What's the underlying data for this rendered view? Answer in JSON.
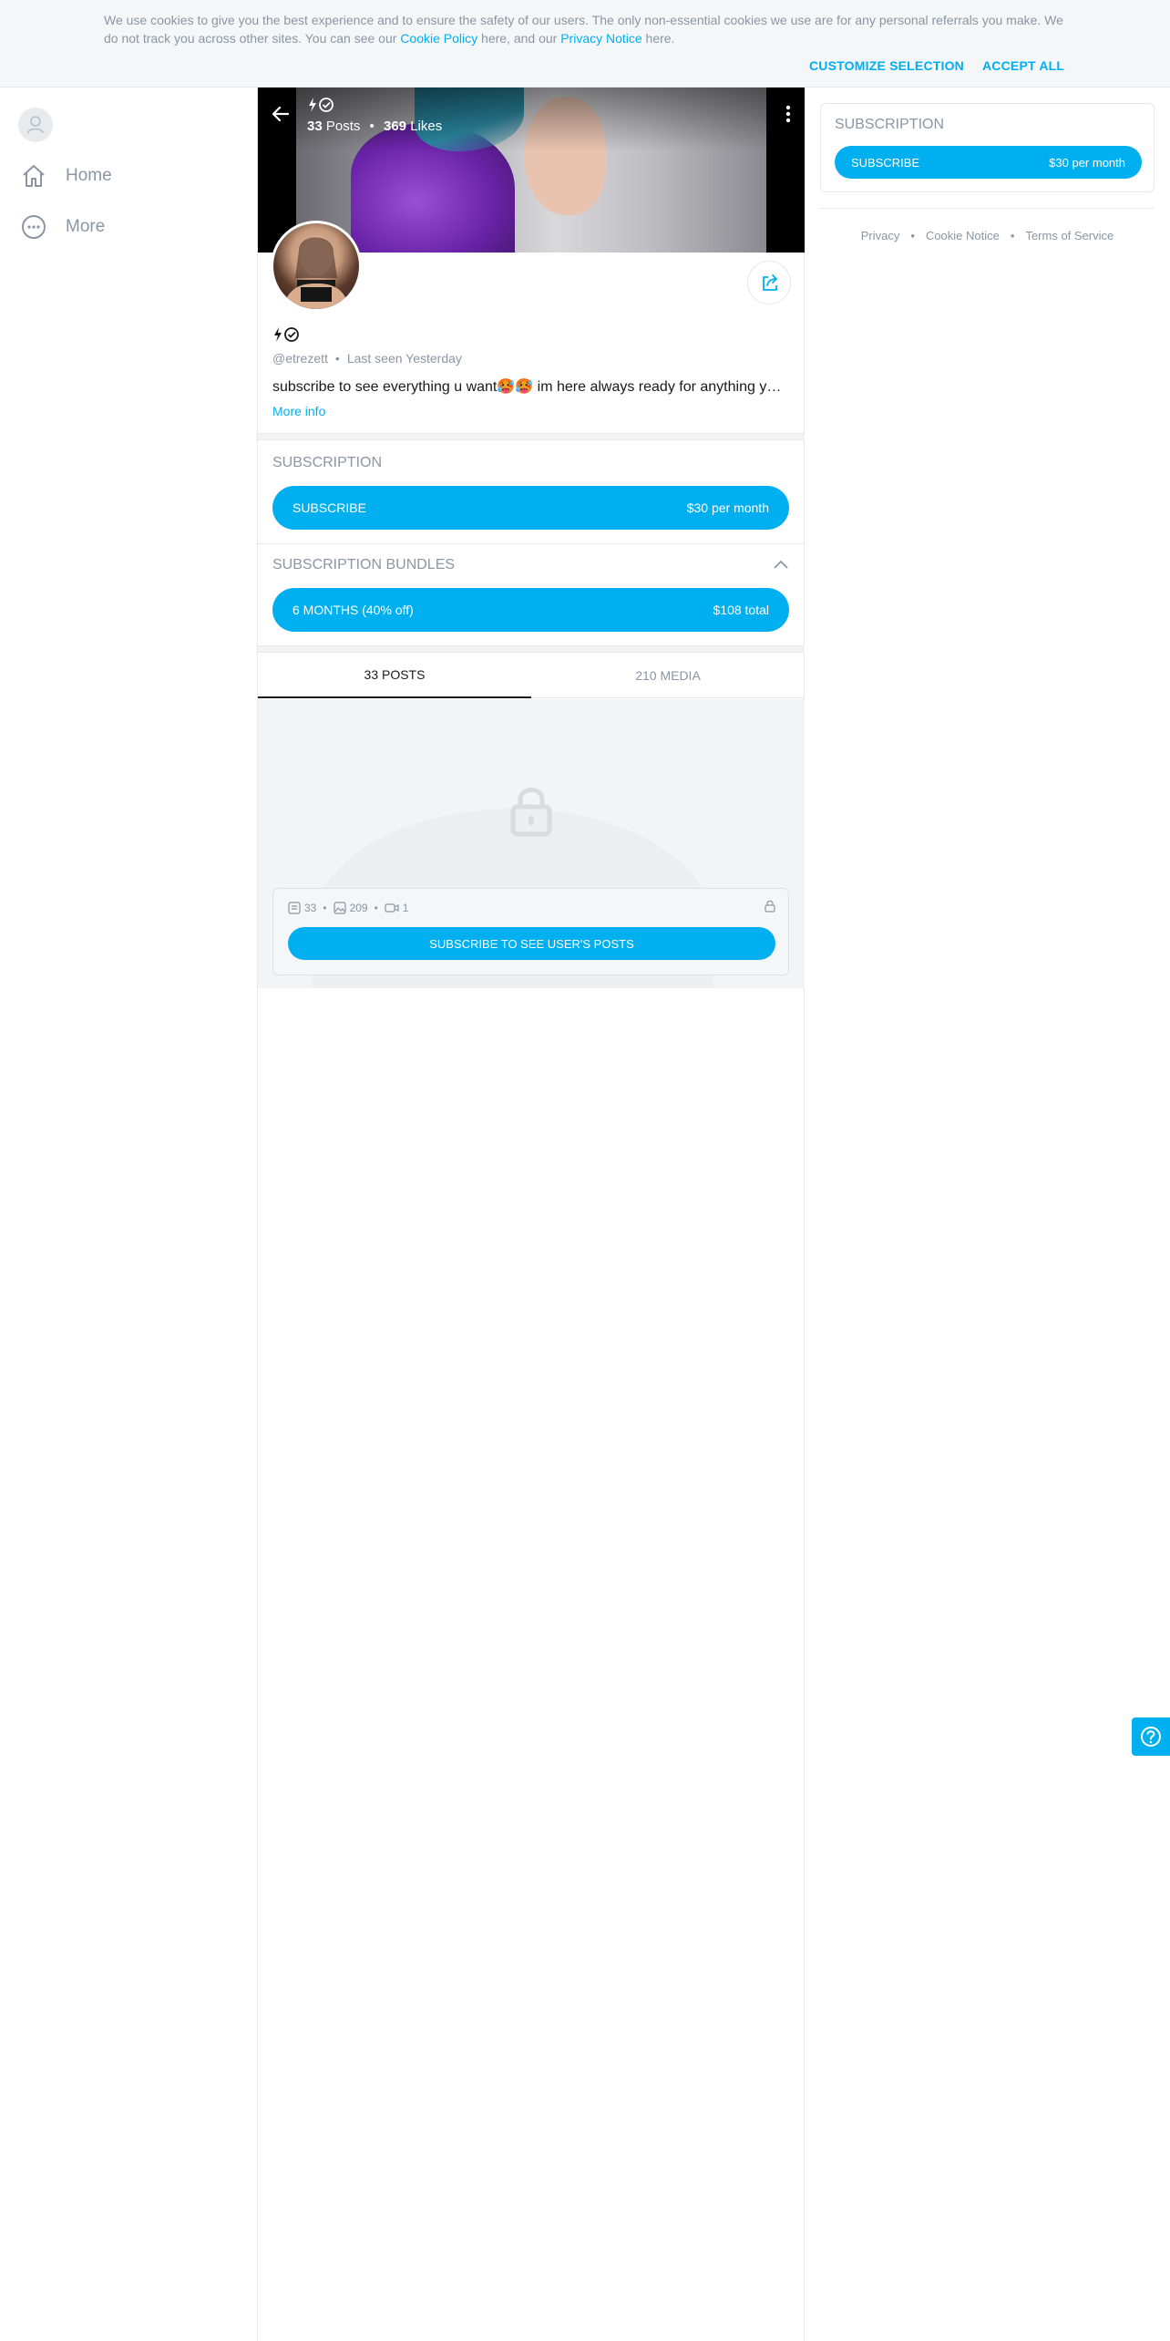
{
  "cookie": {
    "text_before": "We use cookies to give you the best experience and to ensure the safety of our users. The only non-essential cookies we use are for any personal referrals you make. We do not track you across other sites. You can see our ",
    "cookie_link": "Cookie Policy",
    "text_mid": " here, and our ",
    "privacy_link": "Privacy Notice",
    "text_after": " here.",
    "customize_label": "CUSTOMIZE SELECTION",
    "accept_label": "ACCEPT ALL"
  },
  "nav": {
    "items": [
      {
        "label": "Home",
        "icon": "home-icon"
      },
      {
        "label": "More",
        "icon": "more-circle-icon"
      }
    ]
  },
  "profile": {
    "posts_count": "33",
    "posts_label": "Posts",
    "likes_count": "369",
    "likes_label": "Likes",
    "name_badges": "⚡✓",
    "handle": "@etrezett",
    "last_seen": "Last seen Yesterday",
    "bio": "subscribe to see everything u want🥵🥵 im here always ready for anything you want",
    "more_info": "More info"
  },
  "subscription": {
    "title": "SUBSCRIPTION",
    "subscribe_label": "SUBSCRIBE",
    "price": "$30 per month"
  },
  "bundles": {
    "title": "SUBSCRIPTION BUNDLES",
    "bundle_label": "6 MONTHS (40% off)",
    "bundle_price": "$108 total"
  },
  "tabs": [
    {
      "label": "33 POSTS",
      "active": true
    },
    {
      "label": "210 MEDIA",
      "active": false
    }
  ],
  "locked": {
    "posts": "33",
    "images": "209",
    "videos": "1",
    "cta": "SUBSCRIBE TO SEE USER'S POSTS"
  },
  "sidebar": {
    "title": "SUBSCRIPTION",
    "subscribe_label": "SUBSCRIBE",
    "price": "$30 per month",
    "footer": [
      "Privacy",
      "Cookie Notice",
      "Terms of Service"
    ]
  },
  "colors": {
    "accent": "#00aff0",
    "muted": "#8a96a3",
    "border": "#e6e8eb"
  }
}
